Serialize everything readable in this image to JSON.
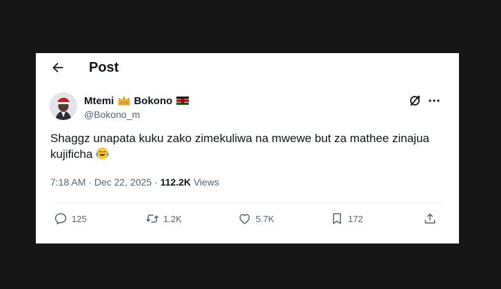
{
  "header": {
    "title": "Post"
  },
  "author": {
    "display_name_first": "Mtemi",
    "display_name_second": "Bokono",
    "handle": "@Bokono_m"
  },
  "post": {
    "text": "Shaggz unapata kuku zako zimekuliwa na mwewe but za mathee zinajua kujificha",
    "emoji": "face-with-tears-of-joy",
    "time": "7:18 AM",
    "date": "Dec 22, 2025",
    "views_count": "112.2K",
    "views_label": "Views"
  },
  "actions": {
    "replies": "125",
    "reposts": "1.2K",
    "likes": "5.7K",
    "bookmarks": "172"
  },
  "colors": {
    "page_background": "#161616",
    "card_background": "#ffffff",
    "text_primary": "#0f1419",
    "text_secondary": "#536471"
  },
  "icons": [
    "back-arrow-icon",
    "crown-icon",
    "kenya-flag-icon",
    "grok-icon",
    "more-icon",
    "reply-icon",
    "repost-icon",
    "like-icon",
    "bookmark-icon",
    "share-icon"
  ]
}
